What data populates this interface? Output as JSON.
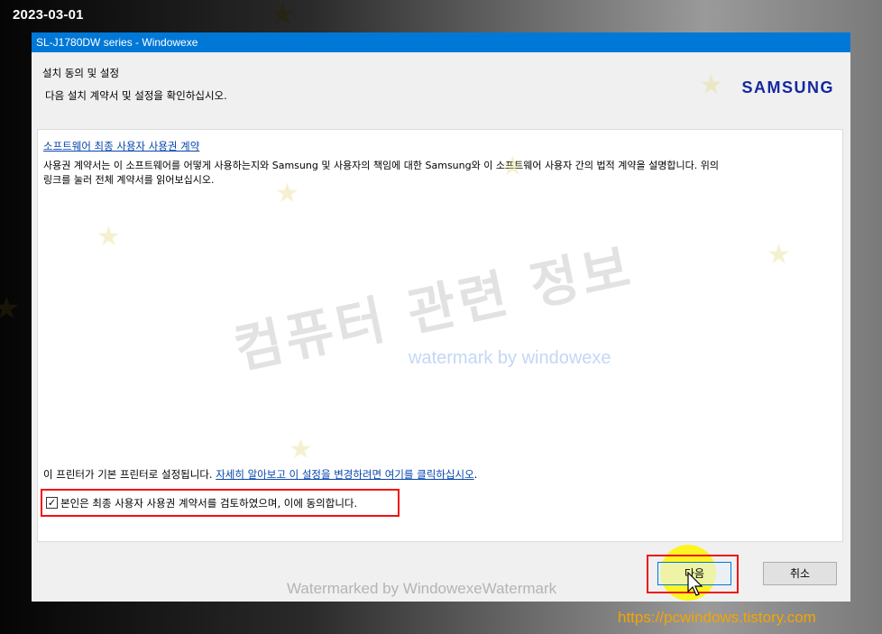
{
  "date_stamp": "2023-03-01",
  "window": {
    "title": "SL-J1780DW series   - Windowexe",
    "header_title": "설치 동의 및 설정",
    "header_subtitle": "다음 설치 계약서 및 설정을 확인하십시오.",
    "logo": "SAMSUNG"
  },
  "eula": {
    "link": "소프트웨어 최종 사용자 사용권 계약",
    "description": "사용권 계약서는 이 소프트웨어를 어떻게 사용하는지와 Samsung 및 사용자의 책임에 대한 Samsung와 이 소프트웨어 사용자 간의 법적 계약을 설명합니다. 위의 링크를 눌러 전체 계약서를 읽어보십시오."
  },
  "default_printer": {
    "text": "이 프린터가 기본 프린터로 설정됩니다. ",
    "link": "자세히 알아보고 이 설정을 변경하려면 여기를 클릭하십시오",
    "suffix": "."
  },
  "agree": {
    "checked": true,
    "check_mark": "✓",
    "label": "본인은 최종 사용자 사용권 계약서를 검토하였으며, 이에 동의합니다."
  },
  "buttons": {
    "next": "다음",
    "cancel": "취소"
  },
  "watermarks": {
    "korean": "컴퓨터 관련 정보",
    "english": "watermark by windowexe",
    "bottom": "Watermarked by WindowexeWatermark"
  },
  "site_url": "https://pcwindows.tistory.com",
  "icons": {
    "cursor": "mouse-pointer-icon",
    "star": "star-icon"
  }
}
